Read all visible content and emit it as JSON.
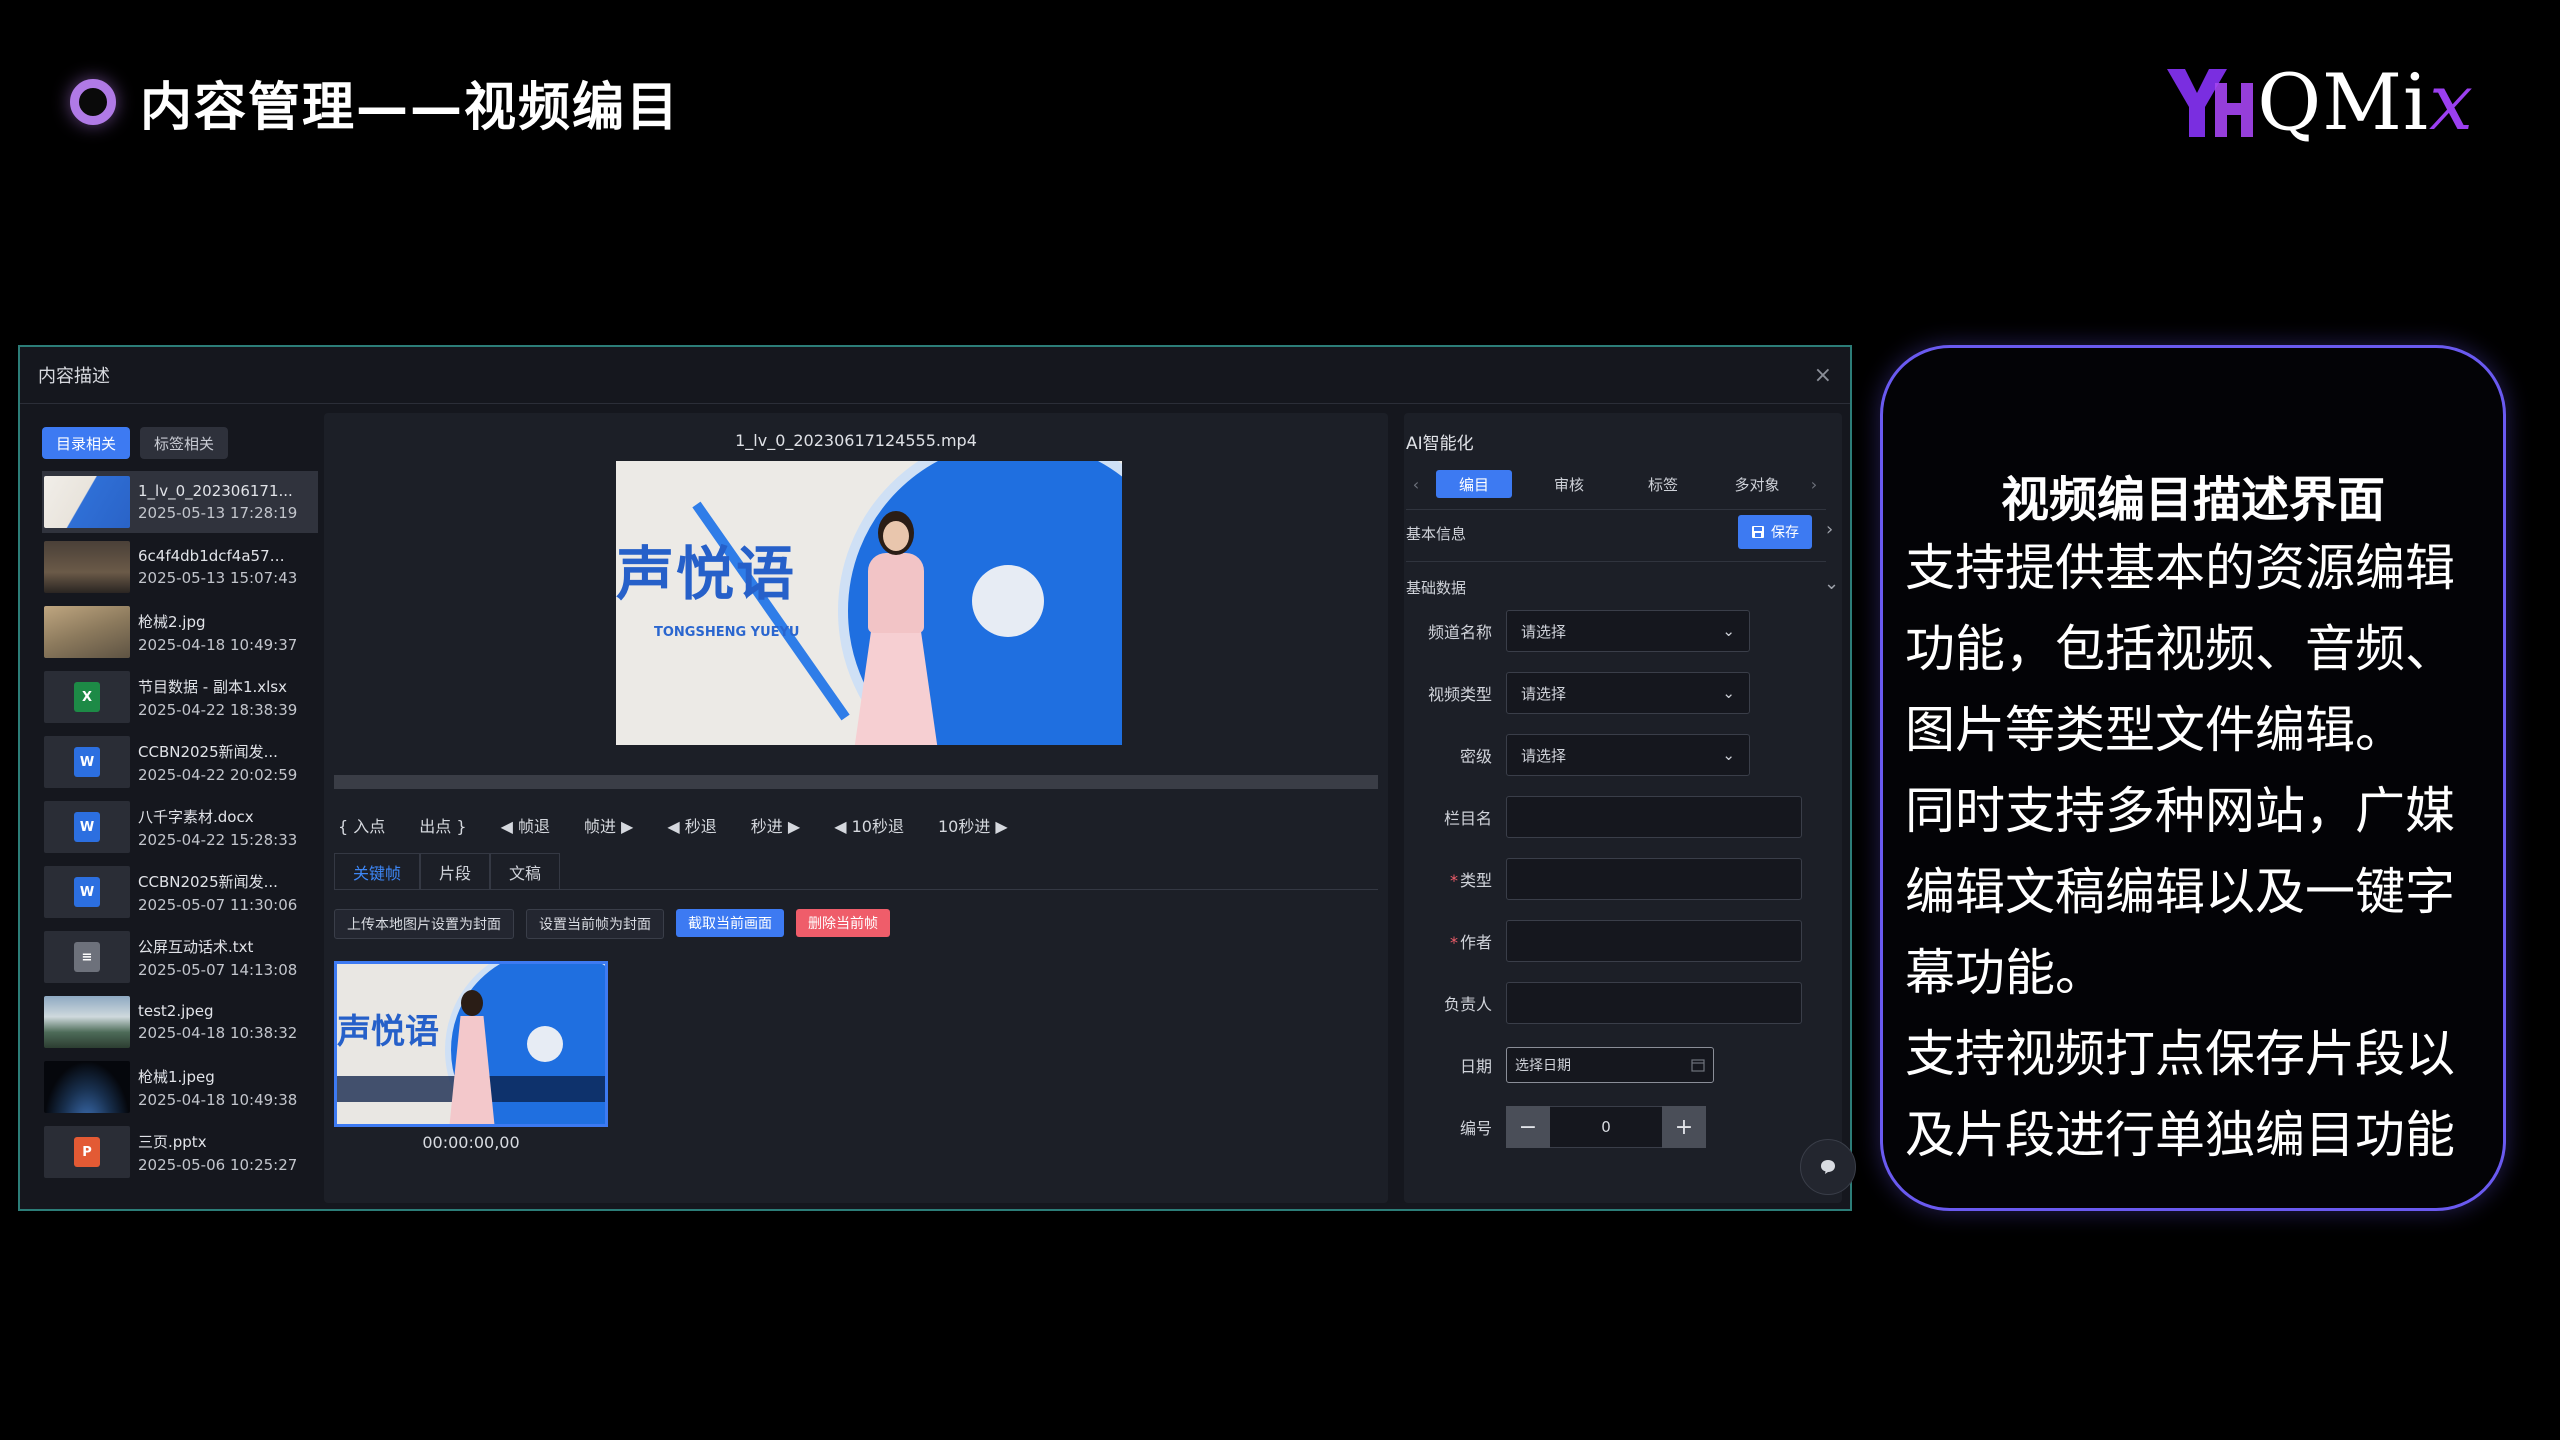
{
  "slide": {
    "title": "内容管理——视频编目",
    "logo_text": "QMi",
    "logo_x": "x"
  },
  "window": {
    "title": "内容描述",
    "close_glyph": "×"
  },
  "file_panel": {
    "tabs": [
      {
        "label": "目录相关",
        "active": true
      },
      {
        "label": "标签相关",
        "active": false
      }
    ],
    "items": [
      {
        "name": "1_lv_0_202306171...",
        "date": "2025-05-13 17:28:19",
        "thumb": "video",
        "active": true
      },
      {
        "name": "6c4f4db1dcf4a5779...",
        "date": "2025-05-13 15:07:43",
        "thumb": "person"
      },
      {
        "name": "枪械2.jpg",
        "date": "2025-04-18 10:49:37",
        "thumb": "soldier"
      },
      {
        "name": "节目数据 - 副本1.xlsx",
        "date": "2025-04-22 18:38:39",
        "thumb": "excel",
        "icon_text": "X"
      },
      {
        "name": "CCBN2025新闻发...",
        "date": "2025-04-22 20:02:59",
        "thumb": "word",
        "icon_text": "W"
      },
      {
        "name": "八千字素材.docx",
        "date": "2025-04-22 15:28:33",
        "thumb": "word",
        "icon_text": "W"
      },
      {
        "name": "CCBN2025新闻发...",
        "date": "2025-05-07 11:30:06",
        "thumb": "word",
        "icon_text": "W"
      },
      {
        "name": "公屏互动话术.txt",
        "date": "2025-05-07 14:13:08",
        "thumb": "txt",
        "icon_text": "≡"
      },
      {
        "name": "test2.jpeg",
        "date": "2025-04-18 10:38:32",
        "thumb": "landscape"
      },
      {
        "name": "枪械1.jpeg",
        "date": "2025-04-18 10:49:38",
        "thumb": "earth"
      },
      {
        "name": "三页.pptx",
        "date": "2025-05-06 10:25:27",
        "thumb": "ppt",
        "icon_text": "P"
      }
    ]
  },
  "player": {
    "file_name": "1_lv_0_20230617124555.mp4",
    "frame_logo": "声悦语",
    "frame_logo_sub": "TONGSHENG YUEYU",
    "controls": [
      "{ 入点",
      "出点 }",
      "◀ 帧退",
      "帧进 ▶",
      "◀ 秒退",
      "秒进 ▶",
      "◀ 10秒退",
      "10秒进 ▶"
    ],
    "sub_tabs": [
      {
        "label": "关键帧",
        "active": true
      },
      {
        "label": "片段",
        "active": false
      },
      {
        "label": "文稿",
        "active": false
      }
    ],
    "actions": [
      {
        "label": "上传本地图片设置为封面",
        "style": "dark"
      },
      {
        "label": "设置当前帧为封面",
        "style": "dark"
      },
      {
        "label": "截取当前画面",
        "style": "blue"
      },
      {
        "label": "删除当前帧",
        "style": "red"
      }
    ],
    "keyframe_logo": "声悦语",
    "keyframe_time": "00:00:00,00"
  },
  "form_panel": {
    "ai_title": "AI智能化",
    "ai_tabs": [
      {
        "label": "编目",
        "active": true
      },
      {
        "label": "审核",
        "active": false
      },
      {
        "label": "标签",
        "active": false
      },
      {
        "label": "多对象",
        "active": false
      }
    ],
    "basic_info_label": "基本信息",
    "save_label": "保存",
    "base_data_label": "基础数据",
    "fields": {
      "channel": {
        "label": "频道名称",
        "value": "请选择"
      },
      "video_type": {
        "label": "视频类型",
        "value": "请选择"
      },
      "secret": {
        "label": "密级",
        "value": "请选择"
      },
      "column": {
        "label": "栏目名",
        "value": ""
      },
      "type": {
        "label": "类型",
        "value": "",
        "required_mark": "*"
      },
      "author": {
        "label": "作者",
        "value": "",
        "required_mark": "*"
      },
      "owner": {
        "label": "负责人",
        "value": ""
      },
      "date": {
        "label": "日期",
        "placeholder": "选择日期"
      },
      "number": {
        "label": "编号",
        "value": "0",
        "minus": "−",
        "plus": "+"
      }
    }
  },
  "description": {
    "title": "视频编目描述界面",
    "paragraphs": [
      "支持提供基本的资源编辑功能，包括视频、音频、图片等类型文件编辑。",
      "同时支持多种网站，广媒编辑文稿编辑以及一键字幕功能。",
      "支持视频打点保存片段以及片段进行单独编目功能"
    ]
  },
  "colors": {
    "accent_blue": "#3d7af2",
    "danger_red": "#ef5d6a",
    "card_border": "#6a5af0",
    "logo_purple": "#9b3ff0"
  }
}
